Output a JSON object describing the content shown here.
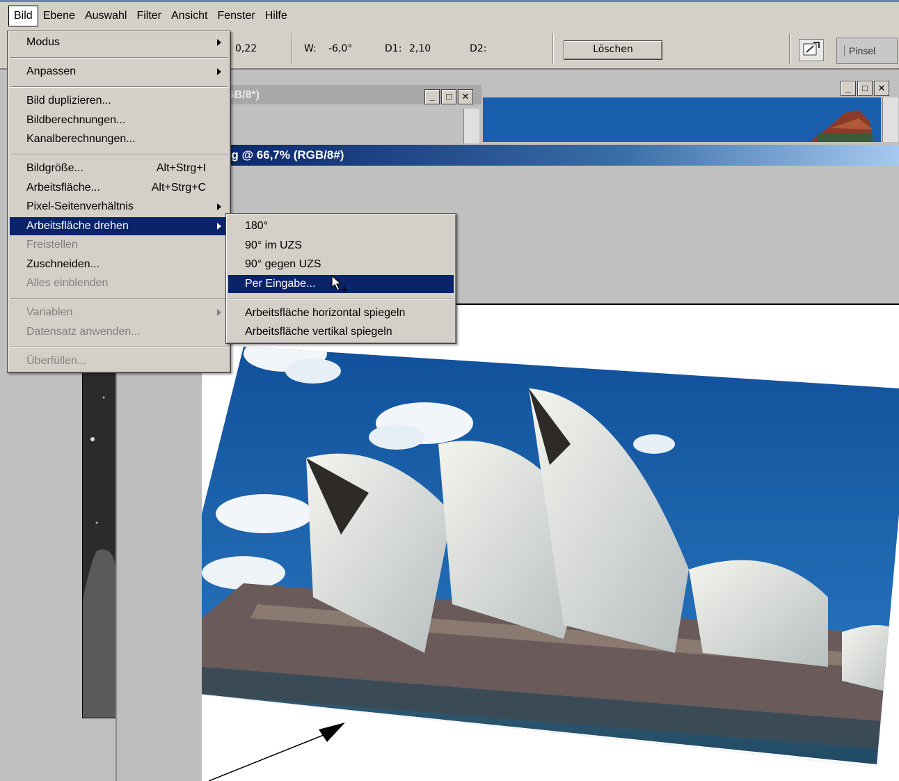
{
  "menubar": {
    "items": [
      "Bild",
      "Ebene",
      "Auswahl",
      "Filter",
      "Ansicht",
      "Fenster",
      "Hilfe"
    ]
  },
  "options_bar": {
    "value_1": "0,22",
    "w_label": "W:",
    "w_value": "-6,0°",
    "d1_label": "D1:",
    "d1_value": "2,10",
    "d2_label": "D2:",
    "clear_button": "Löschen",
    "palette_tab": "Pinsel"
  },
  "windows": {
    "back_title_fragment": "GB/8*)",
    "doc_title": "og @ 66,7% (RGB/8#)"
  },
  "bild_menu": {
    "items": [
      {
        "label": "Modus",
        "submenu": true
      },
      {
        "label": "Anpassen",
        "submenu": true
      },
      {
        "label": "Bild duplizieren..."
      },
      {
        "label": "Bildberechnungen..."
      },
      {
        "label": "Kanalberechnungen..."
      },
      {
        "label": "Bildgröße...",
        "shortcut": "Alt+Strg+I"
      },
      {
        "label": "Arbeitsfläche...",
        "shortcut": "Alt+Strg+C"
      },
      {
        "label": "Pixel-Seitenverhältnis",
        "submenu": true
      },
      {
        "label": "Arbeitsfläche drehen",
        "submenu": true,
        "selected": true
      },
      {
        "label": "Freistellen",
        "disabled": true
      },
      {
        "label": "Zuschneiden..."
      },
      {
        "label": "Alles einblenden",
        "disabled": true
      },
      {
        "label": "Variablen",
        "submenu": true,
        "disabled": true
      },
      {
        "label": "Datensatz anwenden...",
        "disabled": true
      },
      {
        "label": "Überfüllen...",
        "disabled": true
      }
    ]
  },
  "rotate_submenu": {
    "items": [
      {
        "label": "180°"
      },
      {
        "label": "90° im UZS"
      },
      {
        "label": "90° gegen UZS"
      },
      {
        "label": "Per Eingabe...",
        "selected": true
      },
      {
        "label": "Arbeitsfläche horizontal spiegeln"
      },
      {
        "label": "Arbeitsfläche vertikal spiegeln"
      }
    ]
  },
  "colors": {
    "menu_bg": "#d4d0c8",
    "selection": "#0a246a",
    "sky": "#1a5fae"
  }
}
